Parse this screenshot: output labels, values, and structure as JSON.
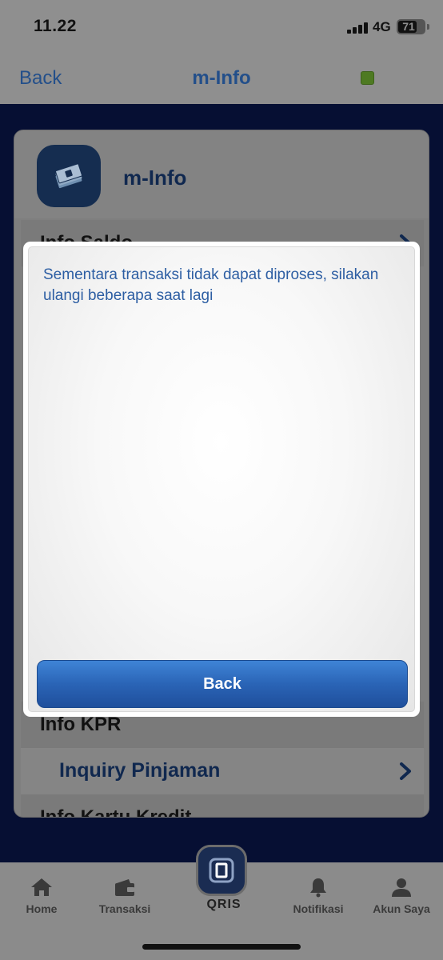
{
  "status_bar": {
    "time": "11.22",
    "network": "4G",
    "battery": "71",
    "battery_level": 0.71
  },
  "nav": {
    "back_label": "Back",
    "title": "m-Info",
    "indicator_color": "#4e7a22"
  },
  "card": {
    "title": "m-Info",
    "icon": "money-stack-icon",
    "rows": [
      {
        "label": "Info Saldo",
        "type": "header-partial"
      },
      {
        "label": "Info KPR",
        "type": "header"
      },
      {
        "label": "Inquiry Pinjaman",
        "type": "item"
      },
      {
        "label": "Info Kartu Kredit",
        "type": "header-partial"
      }
    ]
  },
  "modal": {
    "message": "Sementara transaksi tidak dapat diproses, silakan ulangi beberapa saat lagi",
    "back_label": "Back",
    "button_color": "#2a64b6",
    "text_color": "#2d5ea3"
  },
  "tabs": [
    {
      "label": "Home",
      "icon": "home-icon"
    },
    {
      "label": "Transaksi",
      "icon": "wallet-icon"
    },
    {
      "label": "Notifikasi",
      "icon": "bell-icon"
    },
    {
      "label": "Akun Saya",
      "icon": "person-icon"
    }
  ],
  "qris": {
    "label": "QRIS",
    "icon": "qris-icon"
  }
}
